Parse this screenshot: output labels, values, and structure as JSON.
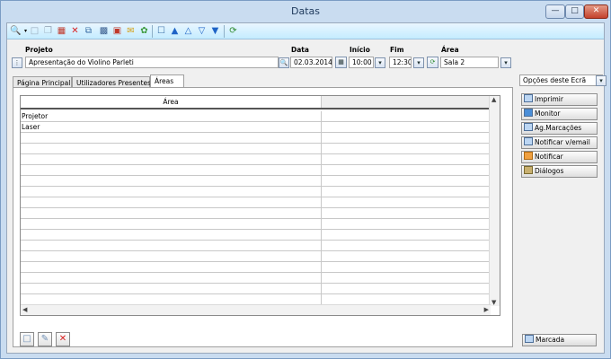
{
  "window": {
    "title": "Datas"
  },
  "form": {
    "projeto_label": "Projeto",
    "projeto_value": "Apresentação do Violino Parleti",
    "data_label": "Data",
    "data_value": "02.03.2014",
    "inicio_label": "Início",
    "inicio_value": "10:00",
    "fim_label": "Fim",
    "fim_value": "12:30",
    "area_label": "Área",
    "area_value": "Sala 2"
  },
  "tabs": [
    "Página Principal",
    "Utilizadores Presentes",
    "Áreas"
  ],
  "grid": {
    "header": "Área",
    "rows": [
      "Projetor",
      "Laser",
      "",
      "",
      "",
      "",
      "",
      "",
      "",
      "",
      "",
      "",
      "",
      "",
      "",
      "",
      "",
      ""
    ]
  },
  "side": {
    "options_label": "Opções deste Ecrã",
    "buttons": [
      "Imprimir",
      "Monitor",
      "Ag.Marcações",
      "Notificar v/email",
      "Notificar",
      "Diálogos"
    ],
    "status_button": "Marcada"
  }
}
